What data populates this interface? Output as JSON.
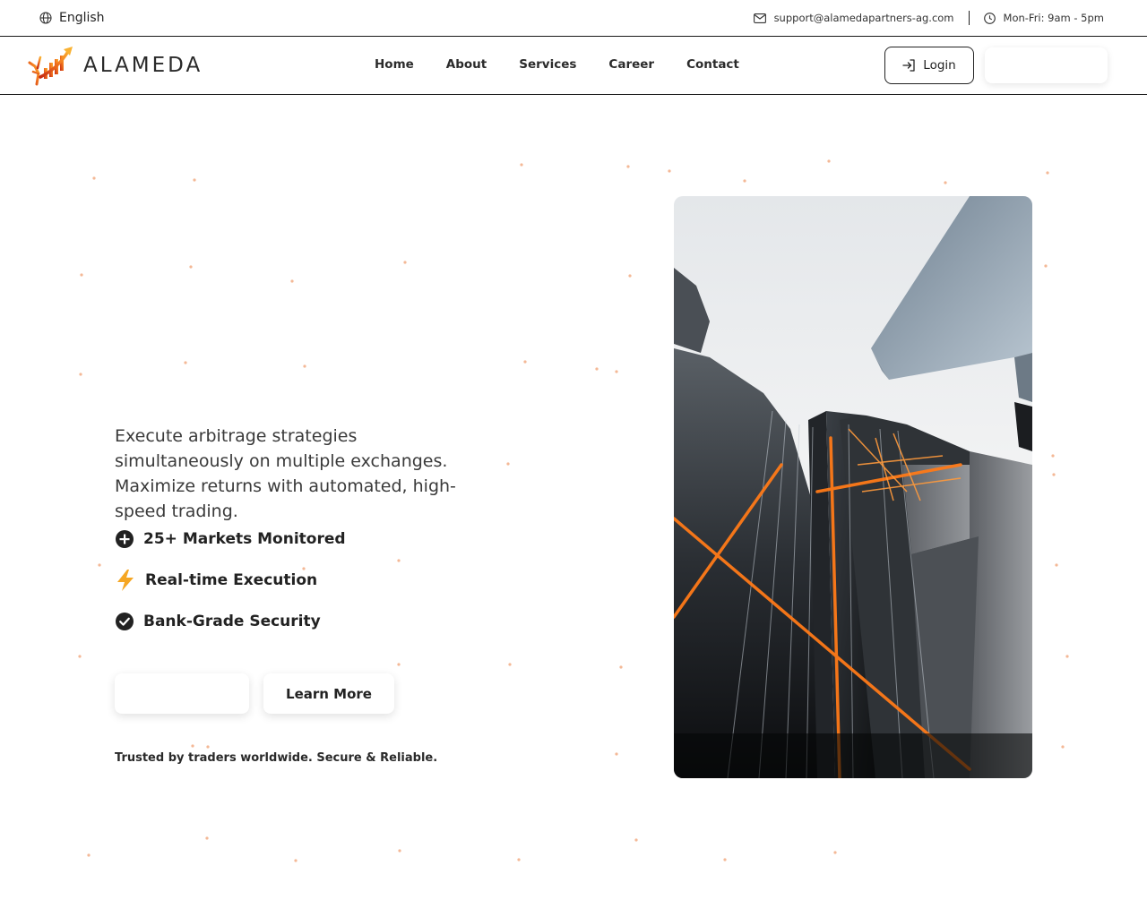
{
  "topbar": {
    "language": "English",
    "email": "support@alamedapartners-ag.com",
    "hours": "Mon-Fri: 9am - 5pm"
  },
  "brand": {
    "name": "ALAMEDA",
    "accent": "#f47a20"
  },
  "nav": {
    "links": [
      "Home",
      "About",
      "Services",
      "Career",
      "Contact"
    ],
    "login_label": "Login"
  },
  "hero": {
    "description": "Execute arbitrage strategies simultaneously on multiple exchanges. Maximize returns with automated, high-speed trading.",
    "features": [
      {
        "icon": "plus-circle-icon",
        "label": "25+ Markets Monitored"
      },
      {
        "icon": "lightning-icon",
        "label": "Real-time Execution"
      },
      {
        "icon": "check-circle-icon",
        "label": "Bank-Grade Security"
      }
    ],
    "learn_more_label": "Learn More",
    "trusted_text": "Trusted by traders worldwide. Secure & Reliable.",
    "image": "skyscraper-photo"
  }
}
